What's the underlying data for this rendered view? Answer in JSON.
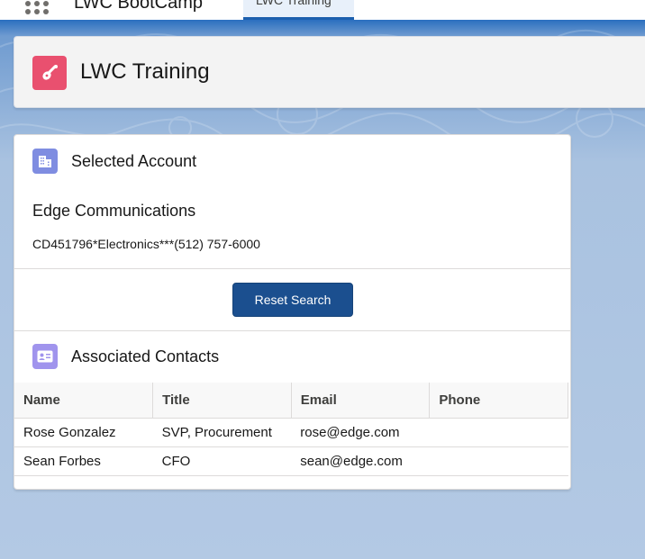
{
  "global_nav": {
    "app_name": "LWC BootCamp",
    "active_tab": "LWC Training"
  },
  "page_header": {
    "title": "LWC Training",
    "icon": "guitar-icon",
    "icon_color": "#e9506f"
  },
  "selected_account": {
    "heading": "Selected Account",
    "icon": "building-icon",
    "name": "Edge Communications",
    "details": "CD451796*Electronics***(512) 757-6000",
    "reset_label": "Reset Search"
  },
  "contacts": {
    "heading": "Associated Contacts",
    "icon": "contact-card-icon",
    "columns": [
      "Name",
      "Title",
      "Email",
      "Phone"
    ],
    "rows": [
      [
        "Rose Gonzalez",
        "SVP, Procurement",
        "rose@edge.com",
        ""
      ],
      [
        "Sean Forbes",
        "CFO",
        "sean@edge.com",
        ""
      ]
    ]
  },
  "colors": {
    "brand_blue": "#1b5fae",
    "button": "#1b4f8f",
    "section_icon": "#7f8de1"
  }
}
